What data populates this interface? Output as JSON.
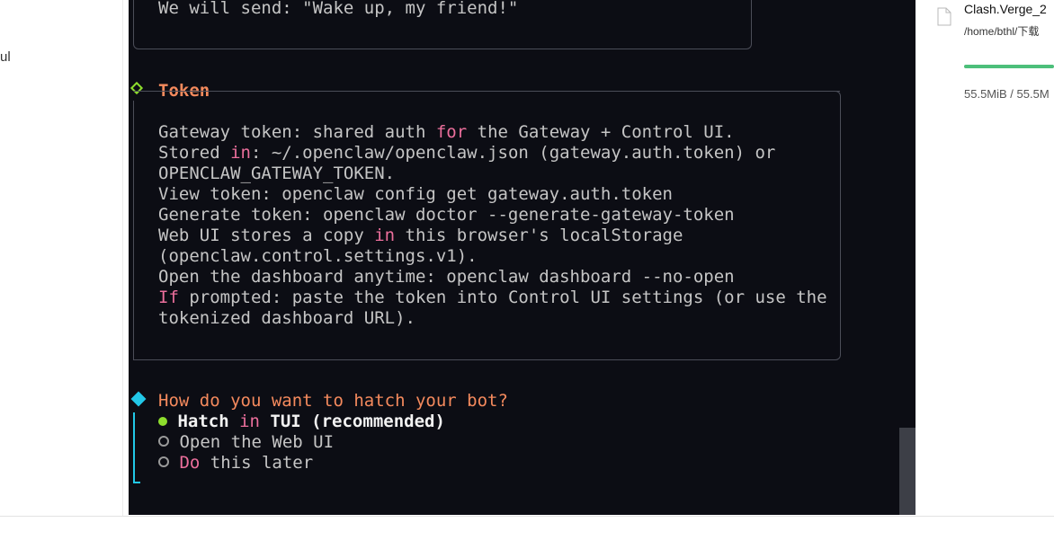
{
  "left_pane": {
    "fragment": "ul"
  },
  "terminal": {
    "previous_line": "We will send: \"Wake up, my friend!\"",
    "token_section": {
      "heading": "Token",
      "lines": [
        [
          {
            "t": "Gateway token: shared auth "
          },
          {
            "t": "for",
            "c": "pink"
          },
          {
            "t": " the Gateway + Control UI."
          }
        ],
        [
          {
            "t": "Stored "
          },
          {
            "t": "in",
            "c": "pink"
          },
          {
            "t": ": ~/.openclaw/openclaw.json (gateway.auth.token) or"
          }
        ],
        [
          {
            "t": "OPENCLAW_GATEWAY_TOKEN."
          }
        ],
        [
          {
            "t": "View token: openclaw config get gateway.auth.token"
          }
        ],
        [
          {
            "t": "Generate token: openclaw doctor --generate-gateway-token"
          }
        ],
        [
          {
            "t": "Web UI stores a copy "
          },
          {
            "t": "in",
            "c": "pink"
          },
          {
            "t": " this browser's localStorage"
          }
        ],
        [
          {
            "t": "(openclaw.control.settings.v1)."
          }
        ],
        [
          {
            "t": "Open the dashboard anytime: openclaw dashboard --no-open"
          }
        ],
        [
          {
            "t": "If",
            "c": "pink"
          },
          {
            "t": " prompted: paste the token into Control UI settings (or use the"
          }
        ],
        [
          {
            "t": "tokenized dashboard URL)."
          }
        ]
      ]
    },
    "prompt": {
      "question": "How do you want to hatch your bot?",
      "options": [
        {
          "selected": true,
          "parts": [
            {
              "t": "Hatch ",
              "c": "white"
            },
            {
              "t": "in",
              "c": "pink"
            },
            {
              "t": " TUI (recommended)",
              "c": "white"
            }
          ]
        },
        {
          "selected": false,
          "parts": [
            {
              "t": "Open the Web UI"
            }
          ]
        },
        {
          "selected": false,
          "parts": [
            {
              "t": "Do",
              "c": "pink"
            },
            {
              "t": " this later"
            }
          ]
        }
      ]
    }
  },
  "download": {
    "file_name": "Clash.Verge_2",
    "path": "/home/bthl/下载",
    "size_text": "55.5MiB / 55.5M",
    "progress": 1.0,
    "icon": "file-icon"
  },
  "colors": {
    "terminal_bg": "#0c0d14",
    "keyword": "#ec6f9c",
    "heading": "#f58a5d",
    "accent_green": "#8ede2d",
    "accent_cyan": "#22c8e8",
    "progress": "#4cbf7a"
  }
}
